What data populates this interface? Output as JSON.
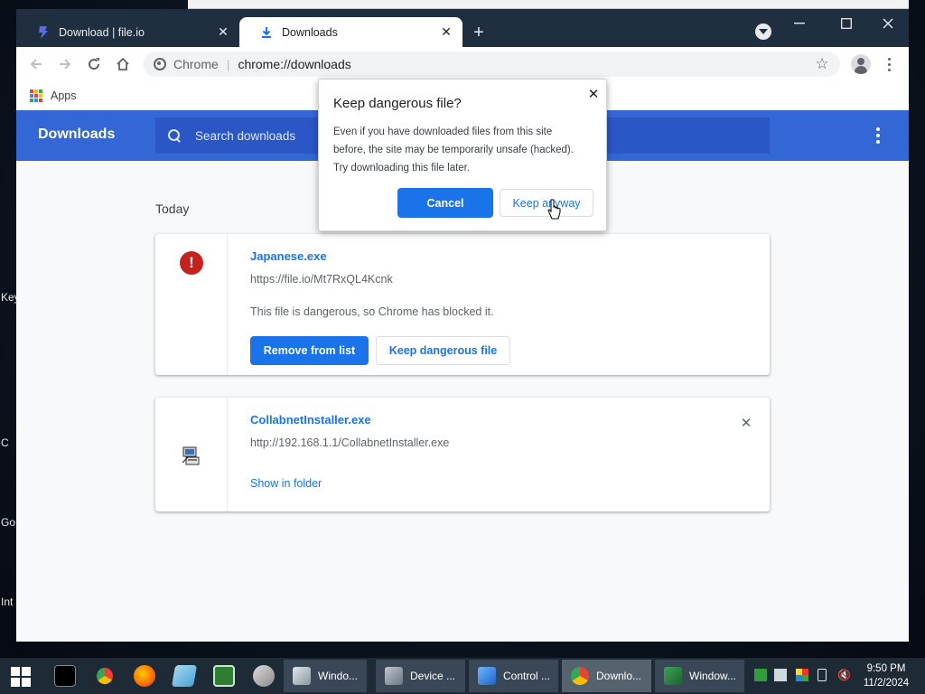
{
  "desktop": {
    "labels": [
      "Key",
      "C",
      "Go",
      "Int"
    ]
  },
  "browser": {
    "tabs": [
      {
        "title": "Download | file.io",
        "active": false,
        "icon": "file-io-favicon"
      },
      {
        "title": "Downloads",
        "active": true,
        "icon": "download-icon"
      }
    ],
    "omnibox": {
      "label": "Chrome",
      "url": "chrome://downloads"
    },
    "bookmarks": {
      "apps_label": "Apps"
    }
  },
  "downloads_page": {
    "title": "Downloads",
    "search_placeholder": "Search downloads",
    "section_label": "Today",
    "items": [
      {
        "file_name": "Japanese.exe",
        "url": "https://file.io/Mt7RxQL4Kcnk",
        "status": "This file is dangerous, so Chrome has blocked it.",
        "primary_action": "Remove from list",
        "secondary_action": "Keep dangerous file",
        "icon": "danger-icon"
      },
      {
        "file_name": "CollabnetInstaller.exe",
        "url": "http://192.168.1.1/CollabnetInstaller.exe",
        "action": "Show in folder",
        "icon": "installer-icon"
      }
    ]
  },
  "dialog": {
    "title": "Keep dangerous file?",
    "body_lines": [
      "Even if you have downloaded files from this site",
      "before, the site may be temporarily unsafe (hacked).",
      "Try downloading this file later."
    ],
    "cancel_label": "Cancel",
    "keep_label": "Keep anyway"
  },
  "taskbar": {
    "tasks": [
      {
        "label": "Windo...",
        "active": false
      },
      {
        "label": "Device ...",
        "active": false
      },
      {
        "label": "Control ...",
        "active": false
      },
      {
        "label": "Downlo...",
        "active": true
      },
      {
        "label": "Window...",
        "active": false
      }
    ],
    "time": "9:50 PM",
    "date": "11/2/2024"
  },
  "colors": {
    "accent_blue": "#1a73e8",
    "header_blue": "#3367d6",
    "danger_red": "#c5221f"
  }
}
